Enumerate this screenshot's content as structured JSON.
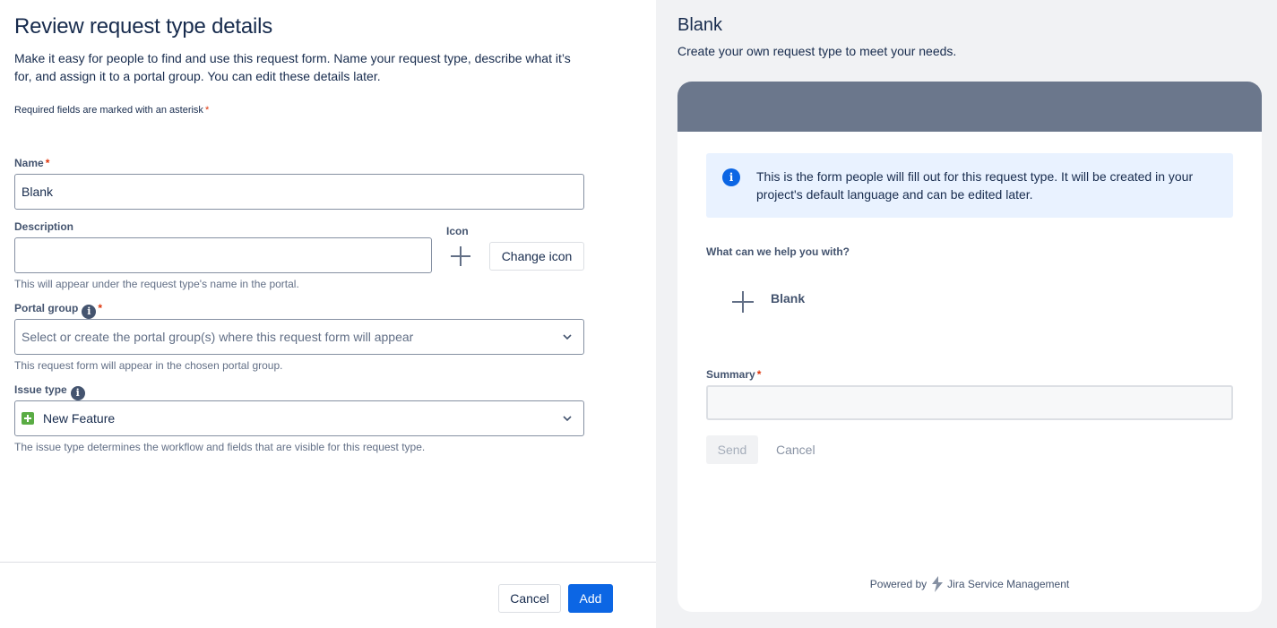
{
  "form": {
    "title": "Review request type details",
    "intro": "Make it easy for people to find and use this request form. Name your request type, describe what it’s for, and assign it to a portal group. You can edit these details later.",
    "required_note": "Required fields are marked with an asterisk",
    "asterisk": "*",
    "name": {
      "label": "Name",
      "value": "Blank"
    },
    "description": {
      "label": "Description",
      "value": "",
      "helper": "This will appear under the request type's name in the portal."
    },
    "icon": {
      "label": "Icon",
      "change_label": "Change icon"
    },
    "portal_group": {
      "label": "Portal group",
      "placeholder": "Select or create the portal group(s) where this request form will appear",
      "helper": "This request form will appear in the chosen portal group."
    },
    "issue_type": {
      "label": "Issue type",
      "value": "New Feature",
      "helper": "The issue type determines the workflow and fields that are visible for this request type."
    },
    "cancel_label": "Cancel",
    "add_label": "Add"
  },
  "preview": {
    "title": "Blank",
    "subtitle": "Create your own request type to meet your needs.",
    "info_text": "This is the form people will fill out for this request type. It will be created in your project's default language and can be edited later.",
    "help_label": "What can we help you with?",
    "request_type_name": "Blank",
    "summary_label": "Summary",
    "send_label": "Send",
    "cancel_label": "Cancel",
    "powered_by": "Powered by",
    "brand": "Jira Service Management"
  },
  "colors": {
    "primary": "#0c66e4",
    "header_band": "#6b778c",
    "info_bg": "#e9f2ff",
    "required": "#de350b",
    "feature_icon": "#5aac44"
  }
}
